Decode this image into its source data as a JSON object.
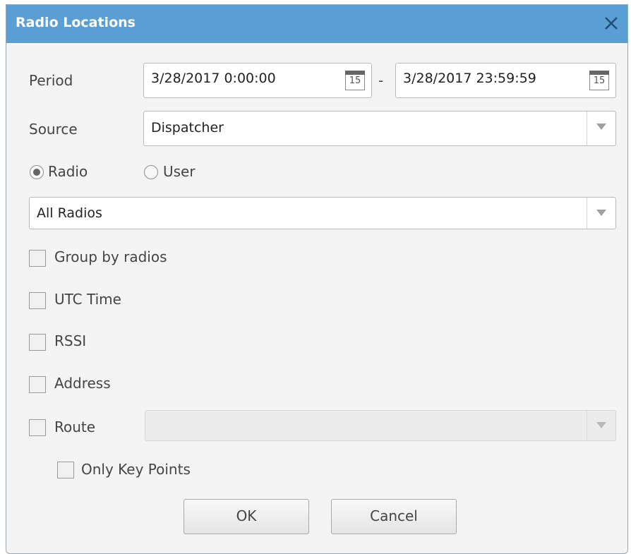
{
  "window": {
    "title": "Radio Locations"
  },
  "period": {
    "label": "Period",
    "from": "3/28/2017 0:00:00",
    "separator": "-",
    "to": "3/28/2017 23:59:59",
    "calendar_day": "15"
  },
  "source": {
    "label": "Source",
    "value": "Dispatcher"
  },
  "mode": {
    "options": [
      {
        "label": "Radio",
        "selected": true
      },
      {
        "label": "User",
        "selected": false
      }
    ]
  },
  "radios_select": {
    "value": "All Radios"
  },
  "options": {
    "group_by_radios": {
      "label": "Group by radios",
      "checked": false
    },
    "utc_time": {
      "label": "UTC Time",
      "checked": false
    },
    "rssi": {
      "label": "RSSI",
      "checked": false
    },
    "address": {
      "label": "Address",
      "checked": false
    },
    "route": {
      "label": "Route",
      "checked": false,
      "value": ""
    },
    "only_key_points": {
      "label": "Only Key Points",
      "checked": false
    }
  },
  "buttons": {
    "ok": "OK",
    "cancel": "Cancel"
  },
  "colors": {
    "titlebar": "#5a9fd4",
    "dialog_bg": "#f4f4f4"
  }
}
